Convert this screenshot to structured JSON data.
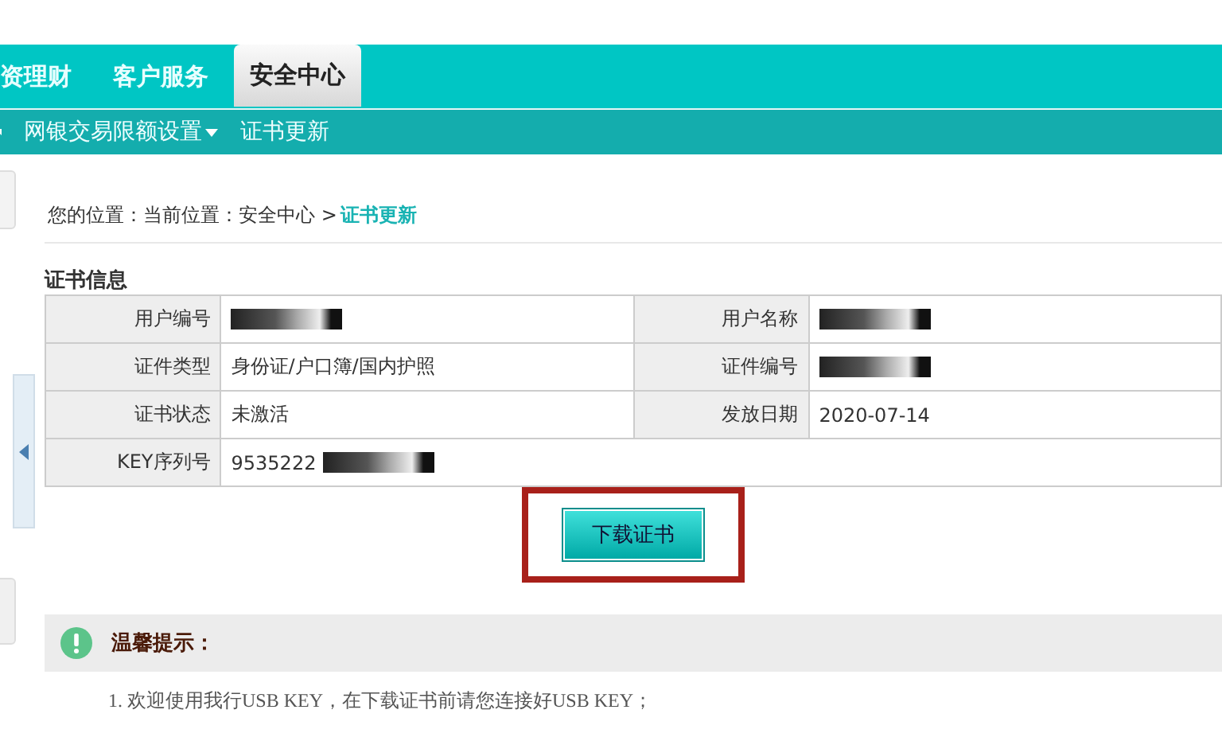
{
  "nav": {
    "tabs": [
      {
        "label": "资理财",
        "selected": false
      },
      {
        "label": "客户服务",
        "selected": false
      },
      {
        "label": "安全中心",
        "selected": true
      }
    ]
  },
  "subnav": {
    "items": [
      {
        "label": "网银交易限额设置",
        "dropdown": true
      },
      {
        "label": "证书更新",
        "dropdown": false
      }
    ]
  },
  "breadcrumb": {
    "prefix": "您的位置：当前位置：安全中心 >",
    "current": "证书更新"
  },
  "certificate": {
    "title": "证书信息",
    "rows": [
      [
        {
          "label": "用户编号",
          "redacted": true
        },
        {
          "label": "用户名称",
          "redacted": true
        }
      ],
      [
        {
          "label": "证件类型",
          "value": "身份证/户口簿/国内护照",
          "redacted": false
        },
        {
          "label": "证件编号",
          "redacted": true
        }
      ],
      [
        {
          "label": "证书状态",
          "value": "未激活",
          "redacted": false
        },
        {
          "label": "发放日期",
          "value": "2020-07-14",
          "redacted": false
        }
      ],
      [
        {
          "label": "KEY序列号",
          "value": "9535222",
          "redacted": true
        }
      ]
    ]
  },
  "download_button": {
    "label": "下载证书",
    "highlighted": true
  },
  "tips": {
    "title": "温馨提示：",
    "lines": [
      "1. 欢迎使用我行USB KEY，在下载证书前请您连接好USB KEY；"
    ]
  }
}
